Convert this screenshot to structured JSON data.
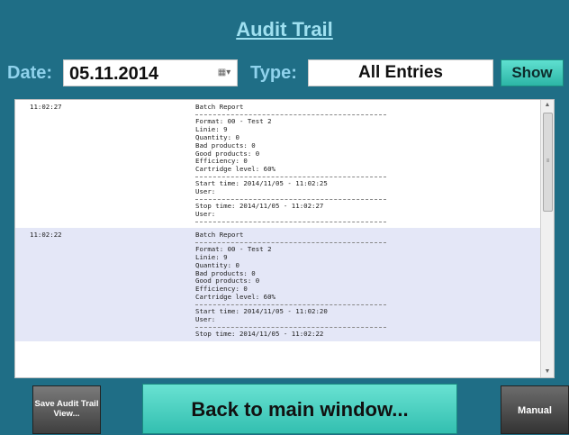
{
  "header": {
    "title": "Audit Trail"
  },
  "filters": {
    "date_label": "Date:",
    "date_value": "05.11.2014",
    "type_label": "Type:",
    "type_value": "All Entries",
    "show_label": "Show"
  },
  "entries": [
    {
      "time": "11:02:27",
      "title": "Batch Report",
      "format": "Format: 00 - Test 2",
      "linie": "Linie: 9",
      "quantity": "Quantity: 0",
      "bad": "Bad products: 0",
      "good": "Good products: 0",
      "efficiency": "Efficiency: 0",
      "cartridge": "Cartridge level: 60%",
      "start": "Start time: 2014/11/05 - 11:02:25",
      "user1": "User:",
      "stop": "Stop time: 2014/11/05 - 11:02:27",
      "user2": "User:"
    },
    {
      "time": "11:02:22",
      "title": "Batch Report",
      "format": "Format: 00 - Test 2",
      "linie": "Linie: 9",
      "quantity": "Quantity: 0",
      "bad": "Bad products: 0",
      "good": "Good products: 0",
      "efficiency": "Efficiency: 0",
      "cartridge": "Cartridge level: 60%",
      "start": "Start time: 2014/11/05 - 11:02:20",
      "user1": "User:",
      "stop": "Stop time: 2014/11/05 - 11:02:22"
    }
  ],
  "footer": {
    "save_line1": "Save Audit Trail",
    "save_line2": "View...",
    "back_label": "Back to main window...",
    "manual_label": "Manual"
  },
  "colors": {
    "background": "#1f6e86",
    "title": "#9fe0f0",
    "accent_button": "#3cc8b8",
    "alt_row": "#e4e7f7"
  }
}
